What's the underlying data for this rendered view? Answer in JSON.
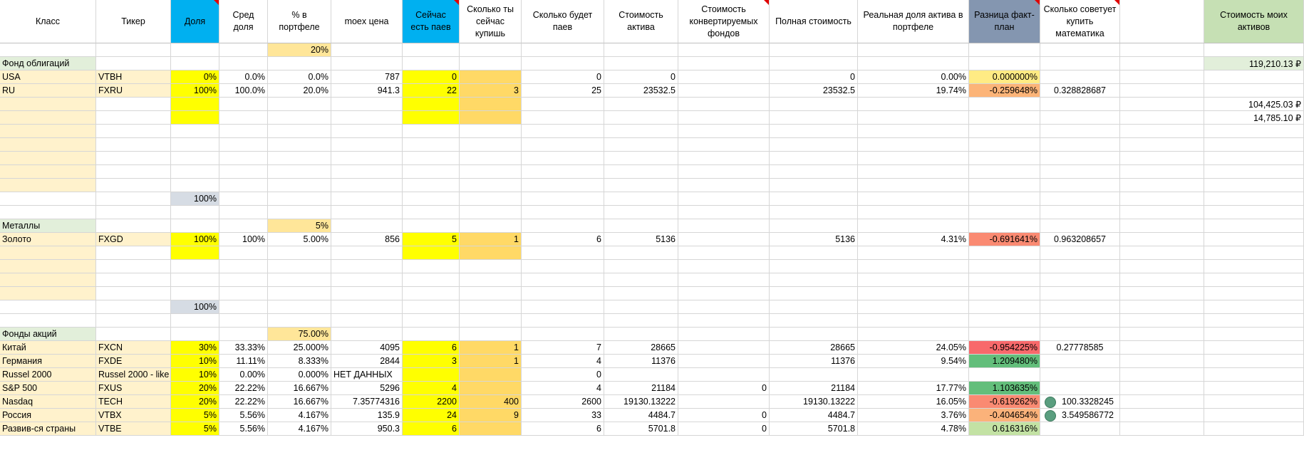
{
  "headers": [
    "Класс",
    "Тикер",
    "Доля",
    "Сред доля",
    "% в портфеле",
    "moex цена",
    "Сейчас есть паев",
    "Сколько ты сейчас купишь",
    "Сколько будет паев",
    "Стоимость актива",
    "Стоимость конвертируемых фондов",
    "Полная стоимость",
    "Реальная доля актива в портфеле",
    "Разница факт-план",
    "Сколько советует купить математика",
    "",
    "",
    "Стоимость моих активов"
  ],
  "header_colors": [
    "",
    "",
    "#00b0f0",
    "",
    "",
    "",
    "#00b0f0",
    "",
    "",
    "",
    "",
    "",
    "",
    "#8496b0",
    "",
    "",
    "",
    "#c6e0b4"
  ],
  "header_comment_marks": [
    2,
    6,
    10,
    13,
    14
  ],
  "colors": {
    "yellow": "#ffff00",
    "orange": "#ffd966",
    "cream": "#fff2cc",
    "lightorange": "#ffe699",
    "green_label": "#e2efda",
    "gray": "#d6dce4",
    "neutral": "#ffeb84",
    "pos_green": "#63be7b",
    "neg_red": "#f8696b",
    "neg_salmon": "#fa8a72",
    "neg_orange": "#fcb478",
    "neg_peach": "#fbb27a",
    "light_green": "#c3e2a4",
    "total_green": "#e2efda"
  },
  "rows": [
    [
      "",
      "",
      "",
      "",
      "20%",
      "",
      "",
      "",
      "",
      "",
      "",
      "",
      "",
      "",
      "",
      "",
      "",
      ""
    ],
    [
      "Фонд облигаций",
      "",
      "",
      "",
      "",
      "",
      "",
      "",
      "",
      "",
      "",
      "",
      "",
      "",
      "",
      "",
      "",
      "119,210.13 ₽"
    ],
    [
      "USA",
      "VTBH",
      "0%",
      "0.0%",
      "0.0%",
      "787",
      "0",
      "",
      "0",
      "0",
      "",
      "0",
      "0.00%",
      "0.000000%",
      "",
      "",
      "",
      ""
    ],
    [
      "RU",
      "FXRU",
      "100%",
      "100.0%",
      "20.0%",
      "941.3",
      "22",
      "3",
      "25",
      "23532.5",
      "",
      "23532.5",
      "19.74%",
      "-0.259648%",
      "0.328828687",
      "",
      "",
      ""
    ],
    [
      "",
      "",
      "",
      "",
      "",
      "",
      "",
      "",
      "",
      "",
      "",
      "",
      "",
      "",
      "",
      "",
      "",
      "104,425.03 ₽"
    ],
    [
      "",
      "",
      "",
      "",
      "",
      "",
      "",
      "",
      "",
      "",
      "",
      "",
      "",
      "",
      "",
      "",
      "",
      "14,785.10 ₽"
    ],
    [
      "",
      "",
      "",
      "",
      "",
      "",
      "",
      "",
      "",
      "",
      "",
      "",
      "",
      "",
      "",
      "",
      "",
      ""
    ],
    [
      "",
      "",
      "",
      "",
      "",
      "",
      "",
      "",
      "",
      "",
      "",
      "",
      "",
      "",
      "",
      "",
      "",
      ""
    ],
    [
      "",
      "",
      "",
      "",
      "",
      "",
      "",
      "",
      "",
      "",
      "",
      "",
      "",
      "",
      "",
      "",
      "",
      ""
    ],
    [
      "",
      "",
      "",
      "",
      "",
      "",
      "",
      "",
      "",
      "",
      "",
      "",
      "",
      "",
      "",
      "",
      "",
      ""
    ],
    [
      "",
      "",
      "",
      "",
      "",
      "",
      "",
      "",
      "",
      "",
      "",
      "",
      "",
      "",
      "",
      "",
      "",
      ""
    ],
    [
      "",
      "",
      "100%",
      "",
      "",
      "",
      "",
      "",
      "",
      "",
      "",
      "",
      "",
      "",
      "",
      "",
      "",
      ""
    ],
    [
      "",
      "",
      "",
      "",
      "",
      "",
      "",
      "",
      "",
      "",
      "",
      "",
      "",
      "",
      "",
      "",
      "",
      ""
    ],
    [
      "Металлы",
      "",
      "",
      "",
      "5%",
      "",
      "",
      "",
      "",
      "",
      "",
      "",
      "",
      "",
      "",
      "",
      "",
      ""
    ],
    [
      "Золото",
      "FXGD",
      "100%",
      "100%",
      "5.00%",
      "856",
      "5",
      "1",
      "6",
      "5136",
      "",
      "5136",
      "4.31%",
      "-0.691641%",
      "0.963208657",
      "",
      "",
      ""
    ],
    [
      "",
      "",
      "",
      "",
      "",
      "",
      "",
      "",
      "",
      "",
      "",
      "",
      "",
      "",
      "",
      "",
      "",
      ""
    ],
    [
      "",
      "",
      "",
      "",
      "",
      "",
      "",
      "",
      "",
      "",
      "",
      "",
      "",
      "",
      "",
      "",
      "",
      ""
    ],
    [
      "",
      "",
      "",
      "",
      "",
      "",
      "",
      "",
      "",
      "",
      "",
      "",
      "",
      "",
      "",
      "",
      "",
      ""
    ],
    [
      "",
      "",
      "",
      "",
      "",
      "",
      "",
      "",
      "",
      "",
      "",
      "",
      "",
      "",
      "",
      "",
      "",
      ""
    ],
    [
      "",
      "",
      "100%",
      "",
      "",
      "",
      "",
      "",
      "",
      "",
      "",
      "",
      "",
      "",
      "",
      "",
      "",
      ""
    ],
    [
      "",
      "",
      "",
      "",
      "",
      "",
      "",
      "",
      "",
      "",
      "",
      "",
      "",
      "",
      "",
      "",
      "",
      ""
    ],
    [
      "Фонды акций",
      "",
      "",
      "",
      "75.00%",
      "",
      "",
      "",
      "",
      "",
      "",
      "",
      "",
      "",
      "",
      "",
      "",
      ""
    ],
    [
      "Китай",
      "FXCN",
      "30%",
      "33.33%",
      "25.000%",
      "4095",
      "6",
      "1",
      "7",
      "28665",
      "",
      "28665",
      "24.05%",
      "-0.954225%",
      "0.27778585",
      "",
      "",
      ""
    ],
    [
      "Германия",
      "FXDE",
      "10%",
      "11.11%",
      "8.333%",
      "2844",
      "3",
      "1",
      "4",
      "11376",
      "",
      "11376",
      "9.54%",
      "1.209480%",
      "",
      "",
      "",
      ""
    ],
    [
      "Russel 2000",
      "Russel 2000 - like",
      "10%",
      "0.00%",
      "0.000%",
      "НЕТ ДАННЫХ",
      "",
      "",
      "0",
      "",
      "",
      "",
      "",
      "",
      "",
      "",
      "",
      ""
    ],
    [
      "S&P 500",
      "FXUS",
      "20%",
      "22.22%",
      "16.667%",
      "5296",
      "4",
      "",
      "4",
      "21184",
      "0",
      "21184",
      "17.77%",
      "1.103635%",
      "",
      "",
      "",
      ""
    ],
    [
      "Nasdaq",
      "TECH",
      "20%",
      "22.22%",
      "16.667%",
      "7.35774316",
      "2200",
      "400",
      "2600",
      "19130.13222",
      "",
      "19130.13222",
      "16.05%",
      "-0.619262%",
      "100.3328245",
      "",
      "",
      ""
    ],
    [
      "Россия",
      "VTBX",
      "5%",
      "5.56%",
      "4.167%",
      "135.9",
      "24",
      "9",
      "33",
      "4484.7",
      "0",
      "4484.7",
      "3.76%",
      "-0.404654%",
      "3.549586772",
      "",
      "",
      ""
    ],
    [
      "Развив-ся страны",
      "VTBE",
      "5%",
      "5.56%",
      "4.167%",
      "950.3",
      "6",
      "",
      "6",
      "5701.8",
      "0",
      "5701.8",
      "4.78%",
      "0.616316%",
      "",
      "",
      "",
      ""
    ]
  ],
  "status_icons": [
    "circle-icon",
    "circle-icon"
  ]
}
